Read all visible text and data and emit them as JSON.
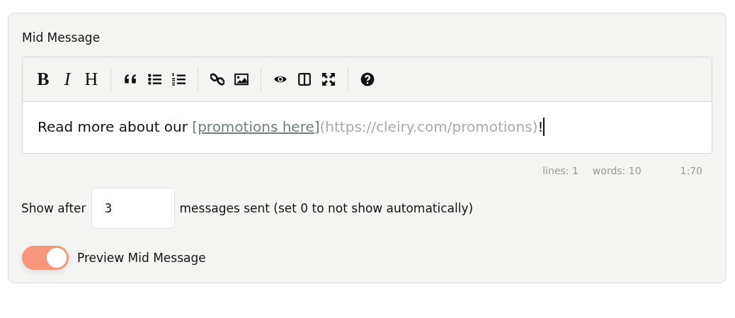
{
  "section": {
    "title": "Mid Message"
  },
  "toolbar": {
    "groups": [
      [
        {
          "kind": "bold",
          "label": "B"
        },
        {
          "kind": "italic",
          "label": "I"
        },
        {
          "kind": "heading",
          "label": "H"
        }
      ],
      [
        {
          "kind": "quote"
        },
        {
          "kind": "bullet-list"
        },
        {
          "kind": "numbered-list"
        }
      ],
      [
        {
          "kind": "link"
        },
        {
          "kind": "image"
        }
      ],
      [
        {
          "kind": "preview"
        },
        {
          "kind": "side-by-side"
        },
        {
          "kind": "fullscreen"
        }
      ],
      [
        {
          "kind": "help"
        }
      ]
    ]
  },
  "editor": {
    "parts": [
      {
        "kind": "plain",
        "text": "Read more about our "
      },
      {
        "kind": "link-text",
        "text": "[promotions here]"
      },
      {
        "kind": "url",
        "text": "(https://cleiry.com/promotions)"
      },
      {
        "kind": "plain",
        "text": "!"
      }
    ]
  },
  "status_bar": {
    "lines": "lines: 1",
    "words": "words: 10",
    "cursor": "1:70"
  },
  "show_after": {
    "label": "Show after",
    "value": "3",
    "suffix": "messages sent (set 0 to not show automatically)"
  },
  "preview_toggle": {
    "label": "Preview Mid Message",
    "on": true
  }
}
